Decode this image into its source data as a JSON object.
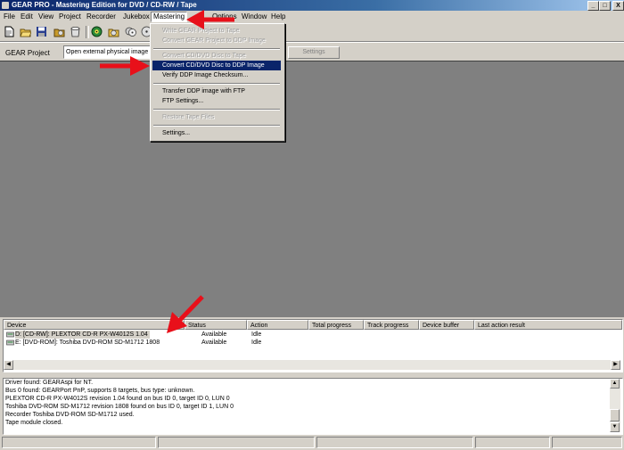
{
  "window": {
    "title": "GEAR PRO - Mastering Edition for DVD / CD-RW / Tape",
    "minimize": "_",
    "maximize": "□",
    "close": "X"
  },
  "menubar": [
    {
      "label": "File"
    },
    {
      "label": "Edit"
    },
    {
      "label": "View"
    },
    {
      "label": "Project"
    },
    {
      "label": "Recorder"
    },
    {
      "label": "Jukebox"
    },
    {
      "label": "Mastering"
    },
    {
      "label": "Options"
    },
    {
      "label": "Window"
    },
    {
      "label": "Help"
    }
  ],
  "project_bar": {
    "label": "GEAR Project",
    "value": "Open external physical image",
    "settings_label": "Settings"
  },
  "mastering_menu": {
    "items": [
      {
        "label": "Write GEAR Project to Tape",
        "enabled": false
      },
      {
        "label": "Convert GEAR Project to DDP Image",
        "enabled": false
      },
      {
        "label": "Convert CD/DVD Disc to Tape",
        "enabled": false
      },
      {
        "label": "Convert CD/DVD Disc to DDP Image",
        "enabled": true,
        "highlighted": true
      },
      {
        "label": "Verify DDP Image Checksum...",
        "enabled": true
      },
      {
        "label": "Transfer DDP image with FTP",
        "enabled": true
      },
      {
        "label": "FTP Settings...",
        "enabled": true
      },
      {
        "label": "Restore Tape Files",
        "enabled": false
      },
      {
        "label": "Settings...",
        "enabled": true
      }
    ]
  },
  "device_table": {
    "columns": [
      "Device",
      "Status",
      "Action",
      "Total progress",
      "Track progress",
      "Device buffer",
      "Last action result"
    ],
    "rows": [
      {
        "device": "D: [CD-RW]:  PLEXTOR CD-R   PX-W4012S 1.04",
        "status": "Available",
        "action": "Idle"
      },
      {
        "device": "E: [DVD-ROM]:  Toshiba DVD-ROM SD-M1712 1808",
        "status": "Available",
        "action": "Idle"
      }
    ]
  },
  "log": {
    "lines": [
      "Driver found: GEARAspi for NT.",
      "Bus 0 found: GEARPort PnP, supports 8 targets, bus type: unknown.",
      "PLEXTOR  CD-R   PX-W4012S revision 1.04 found on bus ID 0, target ID 0, LUN 0",
      "Toshiba  DVD-ROM SD-M1712 revision 1808 found on bus ID 0, target ID 1, LUN 0",
      "Recorder Toshiba DVD-ROM SD-M1712 used.",
      "Tape module closed."
    ]
  },
  "colors": {
    "annotation_arrow": "#e8101a",
    "menu_highlight": "#0a246a",
    "workspace": "#808080",
    "face": "#d4d0c8"
  }
}
